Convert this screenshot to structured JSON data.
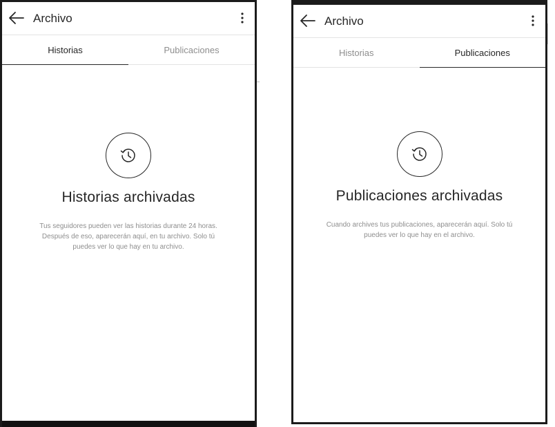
{
  "screens": [
    {
      "header": {
        "title": "Archivo"
      },
      "tabs": [
        {
          "label": "Historias",
          "active": true
        },
        {
          "label": "Publicaciones",
          "active": false
        }
      ],
      "empty_state": {
        "icon": "history-clock-icon",
        "title": "Historias archivadas",
        "description_lines": [
          "Tus seguidores pueden ver las historias durante 24 horas.",
          "Después de eso, aparecerán aquí, en tu archivo. Solo tú",
          "puedes ver lo que hay en tu archivo."
        ]
      }
    },
    {
      "header": {
        "title": "Archivo"
      },
      "tabs": [
        {
          "label": "Historias",
          "active": false
        },
        {
          "label": "Publicaciones",
          "active": true
        }
      ],
      "empty_state": {
        "icon": "history-clock-icon",
        "title": "Publicaciones archivadas",
        "description_lines": [
          "Cuando archives tus publicaciones, aparecerán aquí. Solo tú",
          "puedes ver lo que hay en el archivo."
        ]
      }
    }
  ],
  "colors": {
    "text": "#262626",
    "muted": "#8e8e8e",
    "divider": "#e3e3e3"
  }
}
